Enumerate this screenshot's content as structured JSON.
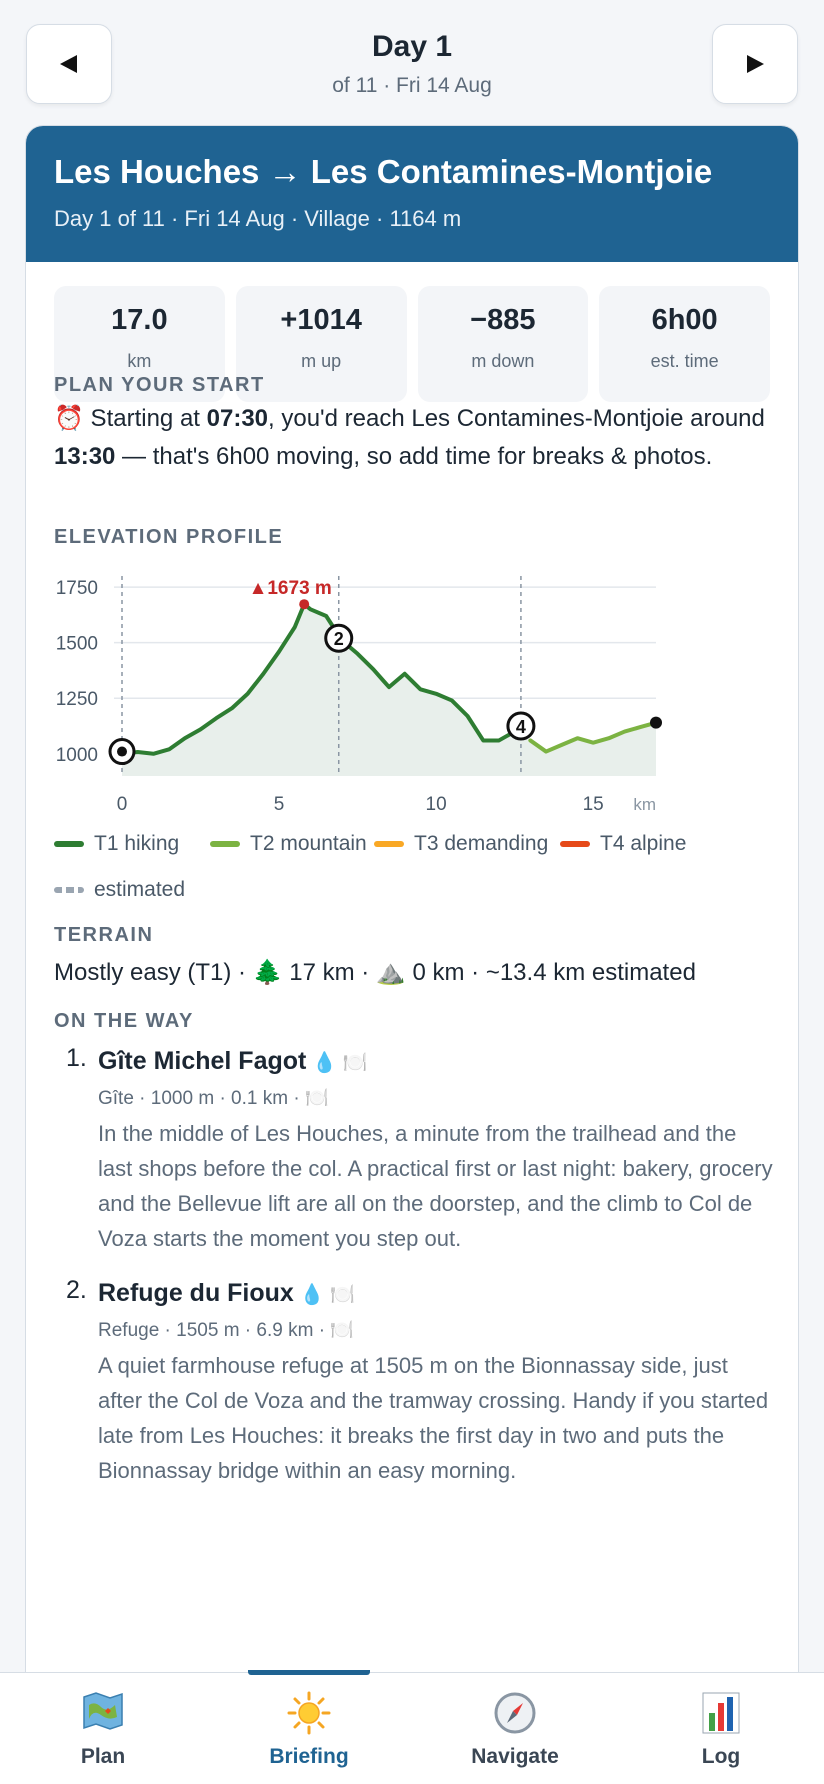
{
  "nav": {
    "prev_icon": "triangle-left",
    "next_icon": "triangle-right",
    "title": "Day 1",
    "subtitle": "of 11 · Fri 14 Aug"
  },
  "header": {
    "title": "Les Houches → Les Contamines-Montjoie",
    "subtitle": "Day 1 of 11 · Fri 14 Aug · Village · 1164 m",
    "color": "#1f6392"
  },
  "stats": [
    {
      "value": "17.0",
      "unit": "km"
    },
    {
      "value": "+1014",
      "unit": "m up"
    },
    {
      "value": "−885",
      "unit": "m down"
    },
    {
      "value": "6h00",
      "unit": "est. time"
    }
  ],
  "plan": {
    "heading": "PLAN YOUR START",
    "icon": "⏰",
    "t1": " Starting at ",
    "start_time": "07:30",
    "t2": ", you'd reach Les Contamines-Montjoie around ",
    "arrive_time": "13:30",
    "t3": " — that's 6h00 moving, so add time for breaks & photos."
  },
  "elevation": {
    "heading": "ELEVATION PROFILE",
    "peak_label": "▲1673 m",
    "x_unit": "km"
  },
  "chart_data": {
    "type": "line",
    "x": [
      0,
      0.5,
      1,
      1.5,
      2,
      2.5,
      3,
      3.5,
      4,
      4.5,
      5,
      5.5,
      5.8,
      6,
      6.5,
      7,
      7.5,
      8,
      8.5,
      9,
      9.5,
      10,
      10.5,
      11,
      11.5,
      12,
      12.5,
      13,
      13.5,
      14,
      14.5,
      15,
      15.5,
      16,
      16.5,
      17
    ],
    "y": [
      1000,
      1008,
      1000,
      1020,
      1070,
      1110,
      1160,
      1205,
      1270,
      1360,
      1460,
      1570,
      1673,
      1650,
      1620,
      1510,
      1450,
      1380,
      1300,
      1360,
      1290,
      1270,
      1240,
      1170,
      1060,
      1060,
      1100,
      1060,
      1010,
      1040,
      1070,
      1050,
      1070,
      1100,
      1120,
      1140
    ],
    "ylim": [
      900,
      1800
    ],
    "xlim": [
      0,
      17
    ],
    "x_ticks": [
      0,
      5,
      10,
      15
    ],
    "y_ticks": [
      1000,
      1250,
      1500,
      1750
    ],
    "xlabel": "km",
    "ylabel": "",
    "peak": {
      "x": 5.8,
      "y": 1673
    },
    "markers": [
      {
        "label": "",
        "x": 0,
        "y": 1010,
        "kind": "start"
      },
      {
        "label": "2",
        "x": 6.9,
        "y": 1520,
        "kind": "waypoint"
      },
      {
        "label": "4",
        "x": 12.7,
        "y": 1125,
        "kind": "waypoint"
      },
      {
        "label": "",
        "x": 17,
        "y": 1140,
        "kind": "end"
      }
    ],
    "vlines": [
      0,
      6.9,
      12.7
    ],
    "segments": [
      {
        "name": "T1 hiking",
        "from": 0,
        "to": 12.7,
        "color": "#2e7d32"
      },
      {
        "name": "T2 mountain",
        "from": 12.7,
        "to": 17,
        "color": "#7cb342"
      }
    ],
    "grid": true
  },
  "legend": [
    {
      "label": "T1 hiking",
      "color": "#2e7d32"
    },
    {
      "label": "T2 mountain",
      "color": "#7cb342"
    },
    {
      "label": "T3 demanding",
      "color": "#f9a825"
    },
    {
      "label": "T4 alpine",
      "color": "#e64a19"
    }
  ],
  "legend_estimated": "estimated",
  "terrain": {
    "heading": "TERRAIN",
    "text": "Mostly easy (T1) · 🌲 17 km · ⛰️ 0 km · ~13.4 km estimated"
  },
  "on_the_way": {
    "heading": "ON THE WAY",
    "stops": [
      {
        "num": "1.",
        "name": "Gîte Michel Fagot",
        "icons": "💧 🍽️",
        "meta": "Gîte · 1000 m · 0.1 km · 🍽️",
        "desc": "In the middle of Les Houches, a minute from the trailhead and the last shops before the col. A practical first or last night: bakery, grocery and the Bellevue lift are all on the doorstep, and the climb to Col de Voza starts the moment you step out."
      },
      {
        "num": "2.",
        "name": "Refuge du Fioux",
        "icons": "💧 🍽️",
        "meta": "Refuge · 1505 m · 6.9 km · 🍽️",
        "desc": "A quiet farmhouse refuge at 1505 m on the Bionnassay side, just after the Col de Voza and the tramway crossing. Handy if you started late from Les Houches: it breaks the first day in two and puts the Bionnassay bridge within an easy morning."
      }
    ]
  },
  "tabs": [
    {
      "label": "Plan",
      "icon": "map-icon",
      "active": false
    },
    {
      "label": "Briefing",
      "icon": "sun-icon",
      "active": true
    },
    {
      "label": "Navigate",
      "icon": "compass-icon",
      "active": false
    },
    {
      "label": "Log",
      "icon": "bar-chart-icon",
      "active": false
    }
  ]
}
